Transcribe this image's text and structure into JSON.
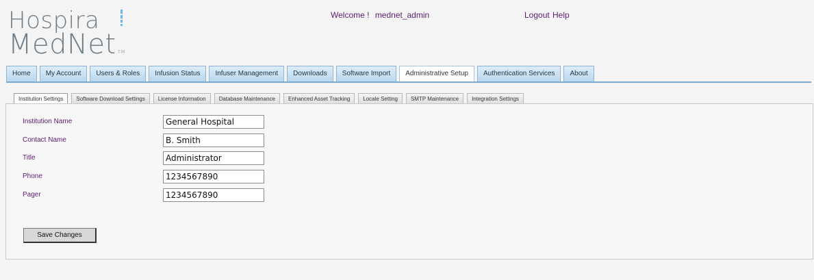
{
  "header": {
    "logo_line1": "Hospira",
    "logo_line2": "MedNet",
    "logo_tm": "TM",
    "welcome_text": "Welcome !",
    "username": "mednet_admin",
    "logout_label": "Logout",
    "help_label": "Help"
  },
  "main_tabs": [
    {
      "label": "Home"
    },
    {
      "label": "My Account"
    },
    {
      "label": "Users & Roles"
    },
    {
      "label": "Infusion Status"
    },
    {
      "label": "Infuser Management"
    },
    {
      "label": "Downloads"
    },
    {
      "label": "Software Import"
    },
    {
      "label": "Administrative Setup",
      "active": true
    },
    {
      "label": "Authentication Services"
    },
    {
      "label": "About"
    }
  ],
  "sub_tabs": [
    {
      "label": "Institution Settings",
      "active": true
    },
    {
      "label": "Software Download Settings"
    },
    {
      "label": "License Information"
    },
    {
      "label": "Database Maintenance"
    },
    {
      "label": "Enhanced Asset Tracking"
    },
    {
      "label": "Locale Setting"
    },
    {
      "label": "SMTP Maintenance"
    },
    {
      "label": "Integration Settings"
    }
  ],
  "form": {
    "fields": [
      {
        "label": "Institution Name",
        "value": "General Hospital"
      },
      {
        "label": "Contact Name",
        "value": "B. Smith"
      },
      {
        "label": "Title",
        "value": "Administrator"
      },
      {
        "label": "Phone",
        "value": "1234567890"
      },
      {
        "label": "Pager",
        "value": "1234567890"
      }
    ],
    "save_label": "Save Changes"
  },
  "colors": {
    "link_purple": "#5c1a6e",
    "tab_blue": "#b9d7ef",
    "logo_gray": "#6e7c86",
    "logo_accent": "#6ab6e0"
  }
}
